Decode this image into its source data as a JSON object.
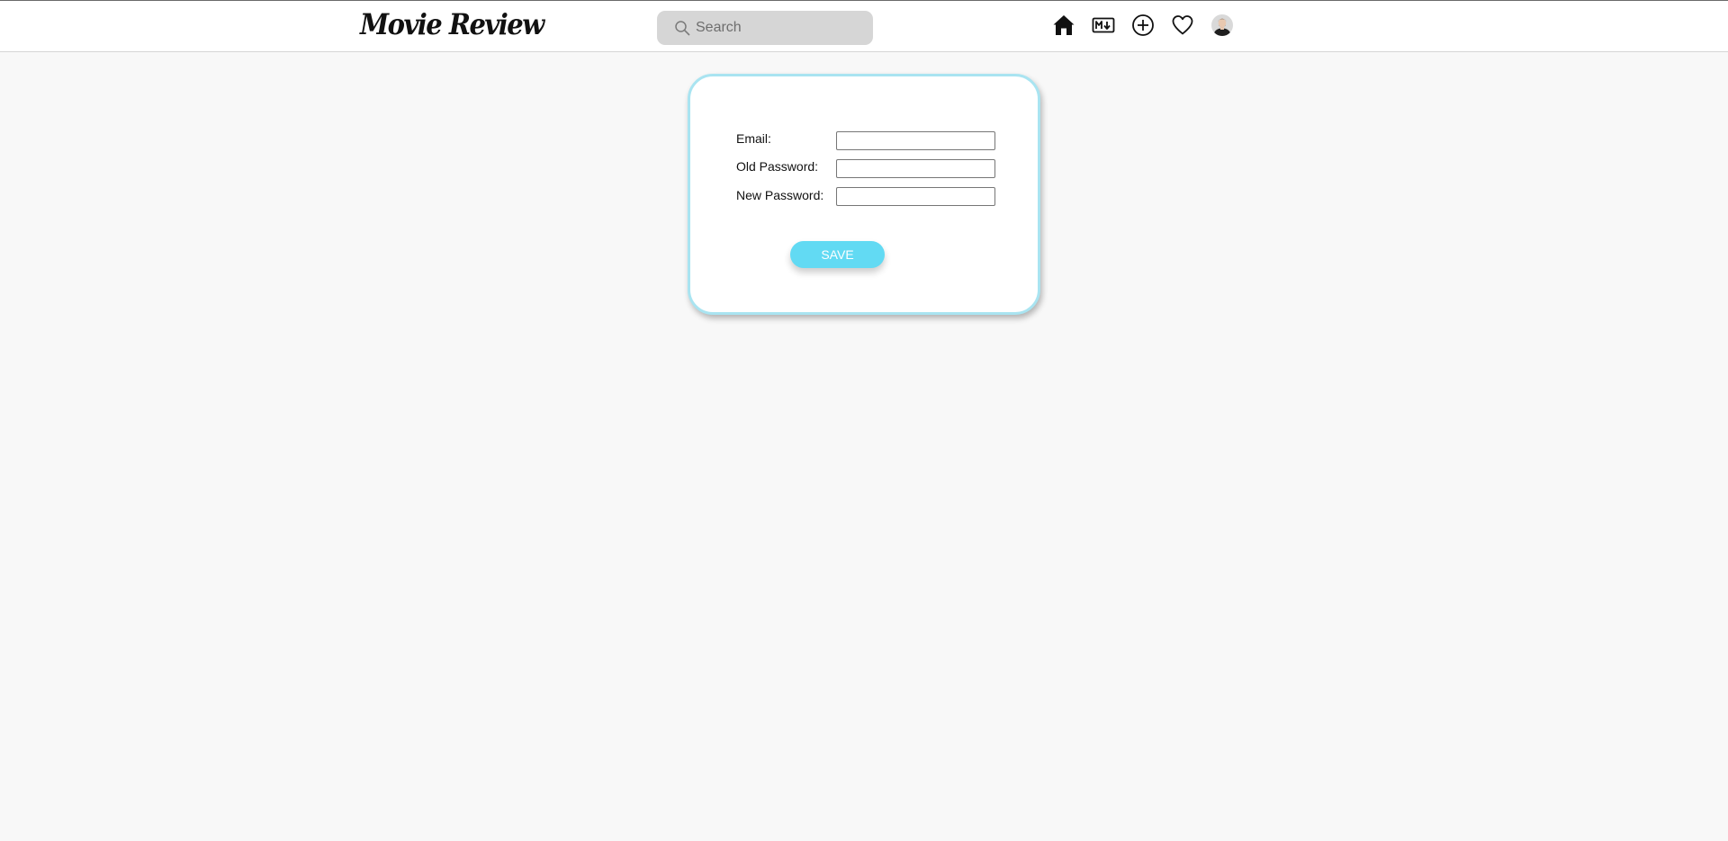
{
  "header": {
    "logo": "Movie Review",
    "search": {
      "placeholder": "Search",
      "value": ""
    },
    "nav_icons": [
      "home-icon",
      "markdown-icon",
      "add-circle-icon",
      "heart-icon",
      "avatar"
    ]
  },
  "form": {
    "email_label": "Email:",
    "old_password_label": "Old Password:",
    "new_password_label": "New Password:",
    "email_value": "",
    "old_password_value": "",
    "new_password_value": "",
    "save_label": "SAVE"
  },
  "colors": {
    "background": "#f8f8f8",
    "card_border": "#a9e4f1",
    "save_button": "#62daf3",
    "search_bg": "#d6d6d6"
  }
}
